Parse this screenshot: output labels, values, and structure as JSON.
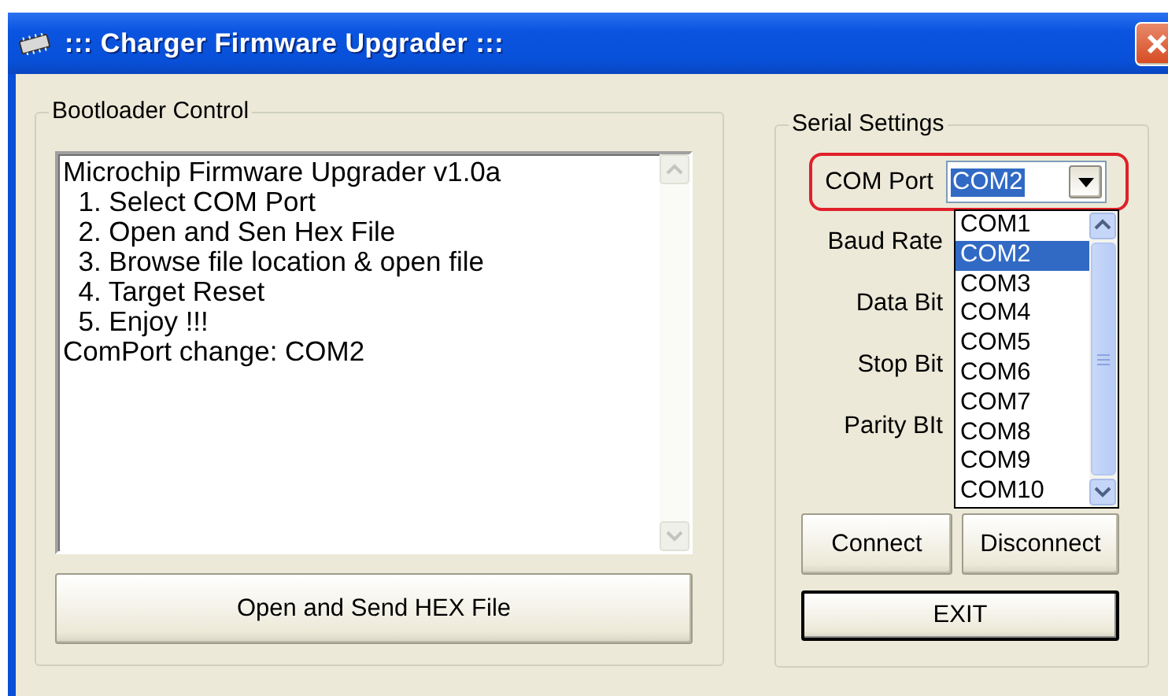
{
  "window": {
    "title": "::: Charger Firmware Upgrader :::"
  },
  "bootloader": {
    "legend": "Bootloader Control",
    "log": [
      "Microchip Firmware Upgrader v1.0a",
      "  1. Select COM Port",
      "  2. Open and Sen Hex File",
      "  3. Browse file location & open file",
      "  4. Target Reset",
      "  5. Enjoy !!!",
      "ComPort change: COM2"
    ],
    "button": "Open and Send HEX File"
  },
  "serial": {
    "legend": "Serial Settings",
    "com_port": {
      "label": "COM Port",
      "value": "COM2",
      "highlighted": true,
      "expanded": true,
      "options": [
        {
          "label": "COM1",
          "selected": false
        },
        {
          "label": "COM2",
          "selected": true
        },
        {
          "label": "COM3",
          "selected": false
        },
        {
          "label": "COM4",
          "selected": false
        },
        {
          "label": "COM5",
          "selected": false
        },
        {
          "label": "COM6",
          "selected": false
        },
        {
          "label": "COM7",
          "selected": false
        },
        {
          "label": "COM8",
          "selected": false
        },
        {
          "label": "COM9",
          "selected": false
        },
        {
          "label": "COM10",
          "selected": false
        }
      ]
    },
    "fields": [
      "Baud Rate",
      "Data Bit",
      "Stop Bit",
      "Parity BIt"
    ],
    "buttons": [
      {
        "label": "Connect",
        "kind": "normal"
      },
      {
        "label": "Disconnect",
        "kind": "normal"
      },
      {
        "label": "EXIT",
        "kind": "default"
      }
    ]
  }
}
